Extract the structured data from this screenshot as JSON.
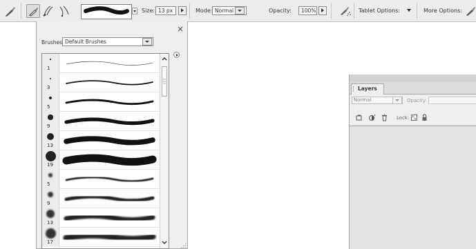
{
  "toolbar": {
    "size_label": "Size:",
    "size_value": "13 px",
    "mode_label": "Mode:",
    "mode_value": "Normal",
    "opacity_label": "Opacity:",
    "opacity_value": "100%",
    "tablet_options_label": "Tablet Options:",
    "more_options_label": "More Options:",
    "icons": [
      "brush-tool-icon",
      "brush-icon",
      "impressionist-brush-icon",
      "color-replacement-icon",
      "airbrush-icon"
    ]
  },
  "brushes_panel": {
    "close_glyph": "×",
    "brushes_label": "Brushes:",
    "brushes_value": "Default Brushes",
    "brushes": [
      {
        "size": "1",
        "kind": "hard"
      },
      {
        "size": "3",
        "kind": "hard"
      },
      {
        "size": "5",
        "kind": "hard"
      },
      {
        "size": "9",
        "kind": "hard"
      },
      {
        "size": "13",
        "kind": "hard"
      },
      {
        "size": "19",
        "kind": "hard"
      },
      {
        "size": "5",
        "kind": "soft"
      },
      {
        "size": "9",
        "kind": "soft"
      },
      {
        "size": "13",
        "kind": "soft"
      },
      {
        "size": "17",
        "kind": "soft"
      }
    ]
  },
  "layers_panel": {
    "tab_label": "Layers",
    "blend_mode": "Normal",
    "opacity_label": "Opacity:",
    "lock_label": "Lock:"
  },
  "colors": {
    "toolbar_bg": "#ececec",
    "panel_bg": "#efefef",
    "stroke": "#111111",
    "layers_body": "#e3e3e3"
  }
}
